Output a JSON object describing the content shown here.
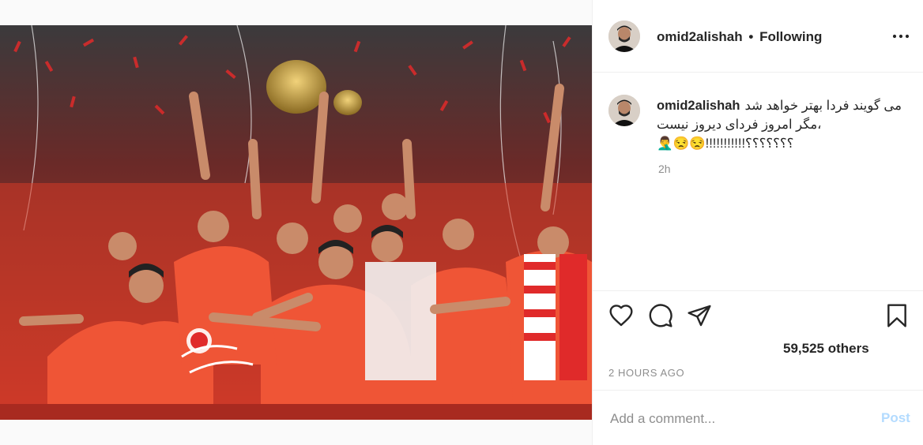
{
  "header": {
    "username": "omid2alishah",
    "separator": "•",
    "follow_status": "Following",
    "more_icon": "more-horizontal-icon"
  },
  "caption": {
    "username": "omid2alishah",
    "text": "می گویند فردا بهتر خواهد شد ،مگر امروز فردای دیروز نیست ؟؟؟؟؟؟؟!!!!!!!!!!!😒😒🤦‍♂️",
    "time": "2h"
  },
  "actions": {
    "like_icon": "heart-icon",
    "comment_icon": "comment-icon",
    "share_icon": "send-icon",
    "save_icon": "bookmark-icon"
  },
  "likes": {
    "text": "59,525 others"
  },
  "post_time": "2 HOURS AGO",
  "comment": {
    "placeholder": "Add a comment...",
    "post_label": "Post"
  },
  "colors": {
    "text": "#262626",
    "muted": "#8e8e8e",
    "divider": "#efefef",
    "post_disabled": "#b3dbff",
    "jersey_red": "#e8452a"
  }
}
